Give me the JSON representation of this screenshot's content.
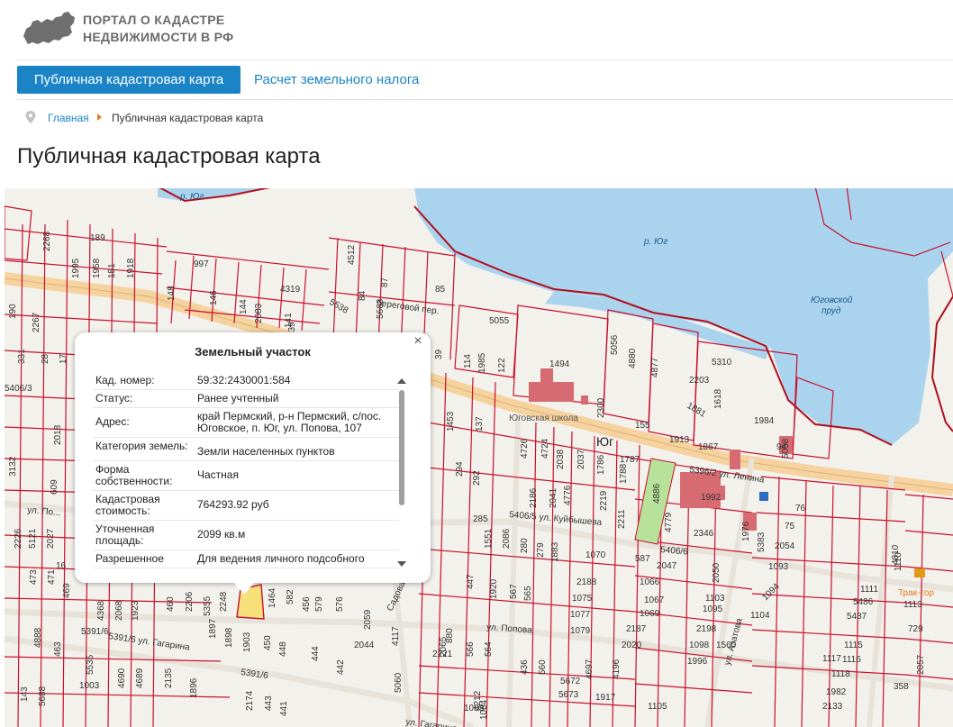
{
  "header": {
    "logo_line1": "ПОРТАЛ О КАДАСТРЕ",
    "logo_line2": "НЕДВИЖИМОСТИ В РФ"
  },
  "nav": {
    "tab_active": "Публичная кадастровая карта",
    "tab_other": "Расчет земельного налога"
  },
  "breadcrumb": {
    "home": "Главная",
    "current": "Публичная кадастровая карта"
  },
  "page_title": "Публичная кадастровая карта",
  "popup": {
    "title": "Земельный участок",
    "close": "×",
    "rows": [
      {
        "key": "Кад. номер:",
        "value": "59:32:2430001:584"
      },
      {
        "key": "Статус:",
        "value": "Ранее учтенный"
      },
      {
        "key": "Адрес:",
        "value": "край Пермский, р-н Пермский, с/пос. Юговское, п. Юг, ул. Попова, 107"
      },
      {
        "key": "Категория земель:",
        "value": "Земли населенных пунктов"
      },
      {
        "key": "Форма собственности:",
        "value": "Частная"
      },
      {
        "key": "Кадастровая стоимость:",
        "value": "764293.92 руб"
      },
      {
        "key": "Уточненная площадь:",
        "value": "2099 кв.м"
      },
      {
        "key": "Разрешенное",
        "value": "Для ведения личного подсобного"
      }
    ]
  },
  "map": {
    "colors": {
      "water": "#aad3ee",
      "parcel": "#c8102e",
      "road": "#f5d29e",
      "highlight": "#f7e07a",
      "building": "#d76b72"
    },
    "labels": [
      {
        "id": "river_top",
        "text": "р. Юг"
      },
      {
        "id": "river_mid",
        "text": "р. Юг"
      },
      {
        "id": "pond1",
        "text": "Юговской"
      },
      {
        "id": "pond2",
        "text": "пруд"
      },
      {
        "id": "street_lenina",
        "text": "5396/2 ул. Ленина"
      },
      {
        "id": "street_kuib",
        "text": "5406/5 ул. Куйбышева"
      },
      {
        "id": "street_5406_6",
        "text": "5406/6"
      },
      {
        "id": "street_popova",
        "text": "ул. Попова"
      },
      {
        "id": "street_gagarina",
        "text": "5391/6 ул. Гагарина"
      },
      {
        "id": "street_5391_6",
        "text": "5391/6"
      },
      {
        "id": "street_beregovoi",
        "text": "береговой пер."
      },
      {
        "id": "street_pol",
        "text": "ул. По..."
      },
      {
        "id": "street_sadovaya",
        "text": "Садовая"
      },
      {
        "id": "street_azatova",
        "text": "ул. Азатова"
      },
      {
        "id": "street_gagarina2",
        "text": "ул. Гагарина"
      },
      {
        "id": "school",
        "text": "Юговская школа"
      },
      {
        "id": "place_yug",
        "text": "Юг"
      },
      {
        "id": "poi_trak",
        "text": "Трак-тор"
      },
      {
        "id": "n5055",
        "text": "5055"
      },
      {
        "id": "n1494",
        "text": "1494"
      },
      {
        "id": "n5310",
        "text": "5310"
      },
      {
        "id": "n1984",
        "text": "1984"
      },
      {
        "id": "n2203",
        "text": "2203"
      },
      {
        "id": "n1618",
        "text": "1618"
      },
      {
        "id": "n1881",
        "text": "1881"
      },
      {
        "id": "n4880",
        "text": "4880"
      },
      {
        "id": "n4877",
        "text": "4877"
      },
      {
        "id": "n5056",
        "text": "5056"
      },
      {
        "id": "n2300",
        "text": "2300"
      },
      {
        "id": "n155",
        "text": "155"
      },
      {
        "id": "n1913",
        "text": "1913"
      },
      {
        "id": "n1867",
        "text": "1867"
      },
      {
        "id": "n1992",
        "text": "1992"
      },
      {
        "id": "n2346",
        "text": "2346"
      },
      {
        "id": "n4886",
        "text": "4886"
      },
      {
        "id": "n4779",
        "text": "4779"
      },
      {
        "id": "n1787",
        "text": "1787"
      },
      {
        "id": "n1788",
        "text": "1788"
      },
      {
        "id": "n1786",
        "text": "1786"
      },
      {
        "id": "n2219",
        "text": "2219"
      },
      {
        "id": "n2211",
        "text": "2211"
      },
      {
        "id": "n4776",
        "text": "4776"
      },
      {
        "id": "n2041",
        "text": "2041"
      },
      {
        "id": "n2186",
        "text": "2186"
      },
      {
        "id": "n2038",
        "text": "2038"
      },
      {
        "id": "n2037",
        "text": "2037"
      },
      {
        "id": "n4726",
        "text": "4726"
      },
      {
        "id": "n4724",
        "text": "4724"
      },
      {
        "id": "n1070",
        "text": "1070"
      },
      {
        "id": "n2188",
        "text": "2188"
      },
      {
        "id": "n1075",
        "text": "1075"
      },
      {
        "id": "n1077",
        "text": "1077"
      },
      {
        "id": "n1079",
        "text": "1079"
      },
      {
        "id": "n1066",
        "text": "1066"
      },
      {
        "id": "n1067",
        "text": "1067"
      },
      {
        "id": "n1069",
        "text": "1069"
      },
      {
        "id": "n2187",
        "text": "2187"
      },
      {
        "id": "n2020",
        "text": "2020"
      },
      {
        "id": "n1103",
        "text": "1103"
      },
      {
        "id": "n1095",
        "text": "1095"
      },
      {
        "id": "n2198",
        "text": "2198"
      },
      {
        "id": "n1098",
        "text": "1098"
      },
      {
        "id": "n1560",
        "text": "1560"
      },
      {
        "id": "n1996",
        "text": "1996"
      },
      {
        "id": "n2047",
        "text": "2047"
      },
      {
        "id": "n2050",
        "text": "2050"
      },
      {
        "id": "n587",
        "text": "587"
      },
      {
        "id": "n1093",
        "text": "1093"
      },
      {
        "id": "n2054",
        "text": "2054"
      },
      {
        "id": "n1094",
        "text": "1094"
      },
      {
        "id": "n1104",
        "text": "1104"
      },
      {
        "id": "n1976",
        "text": "1976"
      },
      {
        "id": "n5383",
        "text": "5383"
      },
      {
        "id": "n75",
        "text": "75"
      },
      {
        "id": "n76",
        "text": "76"
      },
      {
        "id": "n4810",
        "text": "4810"
      },
      {
        "id": "n5486",
        "text": "5486"
      },
      {
        "id": "n5487",
        "text": "5487"
      },
      {
        "id": "n1111",
        "text": "1111"
      },
      {
        "id": "n1110",
        "text": "1110"
      },
      {
        "id": "n1113",
        "text": "1113"
      },
      {
        "id": "n729",
        "text": "729"
      },
      {
        "id": "n1115",
        "text": "1115"
      },
      {
        "id": "n1117",
        "text": "1117"
      },
      {
        "id": "n1116",
        "text": "1116"
      },
      {
        "id": "n1118",
        "text": "1118"
      },
      {
        "id": "n1982",
        "text": "1982"
      },
      {
        "id": "n2133",
        "text": "2133"
      },
      {
        "id": "n2057",
        "text": "2057"
      },
      {
        "id": "n358",
        "text": "358"
      },
      {
        "id": "n1464",
        "text": "1464"
      },
      {
        "id": "n582",
        "text": "582"
      },
      {
        "id": "n456",
        "text": "456"
      },
      {
        "id": "n579",
        "text": "579"
      },
      {
        "id": "n576",
        "text": "576"
      },
      {
        "id": "n2059",
        "text": "2059"
      },
      {
        "id": "n2044",
        "text": "2044"
      },
      {
        "id": "n1920",
        "text": "1920"
      },
      {
        "id": "n567",
        "text": "567"
      },
      {
        "id": "n565",
        "text": "565"
      },
      {
        "id": "n447",
        "text": "447"
      },
      {
        "id": "n2221",
        "text": "2221"
      },
      {
        "id": "n1083",
        "text": "1083"
      },
      {
        "id": "n1084",
        "text": "1084"
      },
      {
        "id": "n2044b",
        "text": "4117"
      },
      {
        "id": "n2065",
        "text": "2065"
      },
      {
        "id": "n880",
        "text": "880"
      },
      {
        "id": "n566",
        "text": "566"
      },
      {
        "id": "n564",
        "text": "564"
      },
      {
        "id": "n436",
        "text": "436"
      },
      {
        "id": "n560",
        "text": "560"
      },
      {
        "id": "n5672",
        "text": "5672"
      },
      {
        "id": "n5673",
        "text": "5673"
      },
      {
        "id": "n1917",
        "text": "1917"
      },
      {
        "id": "n4697",
        "text": "4697"
      },
      {
        "id": "n1105",
        "text": "1105"
      },
      {
        "id": "n4196",
        "text": "4196"
      },
      {
        "id": "n5060",
        "text": "5060"
      },
      {
        "id": "n1903",
        "text": "1903"
      },
      {
        "id": "n450",
        "text": "450"
      },
      {
        "id": "n448",
        "text": "448"
      },
      {
        "id": "n444",
        "text": "444"
      },
      {
        "id": "n442",
        "text": "442"
      },
      {
        "id": "n1898",
        "text": "1898"
      },
      {
        "id": "n2135",
        "text": "2135"
      },
      {
        "id": "n4212",
        "text": "4212"
      },
      {
        "id": "n5535",
        "text": "5535"
      },
      {
        "id": "n4690",
        "text": "4690"
      },
      {
        "id": "n4689",
        "text": "4689"
      },
      {
        "id": "n1003",
        "text": "1003"
      },
      {
        "id": "n4888",
        "text": "4888"
      },
      {
        "id": "n463",
        "text": "463"
      },
      {
        "id": "n5688",
        "text": "5688"
      },
      {
        "id": "n143",
        "text": "143"
      },
      {
        "id": "n2174",
        "text": "2174"
      },
      {
        "id": "n443",
        "text": "443"
      },
      {
        "id": "n1896",
        "text": "1896"
      },
      {
        "id": "n441",
        "text": "441"
      },
      {
        "id": "n4512",
        "text": "4512"
      },
      {
        "id": "n997",
        "text": "997"
      },
      {
        "id": "n189",
        "text": "189"
      },
      {
        "id": "n4319",
        "text": "4319"
      },
      {
        "id": "n5538",
        "text": "5538"
      },
      {
        "id": "n87",
        "text": "87"
      },
      {
        "id": "n85",
        "text": "85"
      },
      {
        "id": "n84",
        "text": "84"
      },
      {
        "id": "n5663",
        "text": "5663"
      },
      {
        "id": "n1918",
        "text": "1918"
      },
      {
        "id": "n1995",
        "text": "1995"
      },
      {
        "id": "n1958",
        "text": "1958"
      },
      {
        "id": "n151",
        "text": "151"
      },
      {
        "id": "n148",
        "text": "148"
      },
      {
        "id": "n146",
        "text": "146"
      },
      {
        "id": "n144",
        "text": "144"
      },
      {
        "id": "n2083",
        "text": "2083"
      },
      {
        "id": "n141",
        "text": "141"
      },
      {
        "id": "n139",
        "text": "139"
      },
      {
        "id": "n2267",
        "text": "2267"
      },
      {
        "id": "n2268",
        "text": "2268"
      },
      {
        "id": "n190",
        "text": "190"
      },
      {
        "id": "n331",
        "text": "331"
      },
      {
        "id": "n28",
        "text": "28"
      },
      {
        "id": "n17",
        "text": "17"
      },
      {
        "id": "n5406_3",
        "text": "5406/3"
      },
      {
        "id": "n3132",
        "text": "3132"
      },
      {
        "id": "n2018",
        "text": "2018"
      },
      {
        "id": "n609",
        "text": "609"
      },
      {
        "id": "n2027",
        "text": "2027"
      },
      {
        "id": "n5121",
        "text": "5121"
      },
      {
        "id": "n2226",
        "text": "2226"
      },
      {
        "id": "n473",
        "text": "473"
      },
      {
        "id": "n471",
        "text": "471"
      },
      {
        "id": "n469",
        "text": "469"
      },
      {
        "id": "n39",
        "text": "39"
      },
      {
        "id": "n114",
        "text": "114"
      },
      {
        "id": "n1985",
        "text": "1985"
      },
      {
        "id": "n122",
        "text": "122"
      },
      {
        "id": "n1453",
        "text": "1453"
      },
      {
        "id": "n137",
        "text": "137"
      },
      {
        "id": "n294",
        "text": "294"
      },
      {
        "id": "n292",
        "text": "292"
      },
      {
        "id": "n285",
        "text": "285"
      },
      {
        "id": "n1551",
        "text": "1551"
      },
      {
        "id": "n2086",
        "text": "2086"
      },
      {
        "id": "n280",
        "text": "280"
      },
      {
        "id": "n279",
        "text": "279"
      },
      {
        "id": "n1883",
        "text": "1883"
      },
      {
        "id": "n4368",
        "text": "4368"
      },
      {
        "id": "n2068",
        "text": "2068"
      },
      {
        "id": "n1923",
        "text": "1923"
      },
      {
        "id": "n460",
        "text": "460"
      },
      {
        "id": "n2206",
        "text": "2206"
      },
      {
        "id": "n5355",
        "text": "5355"
      },
      {
        "id": "n2248",
        "text": "2248"
      },
      {
        "id": "n1897",
        "text": "1897"
      },
      {
        "id": "n5391_6",
        "text": "5391/6"
      },
      {
        "id": "n16",
        "text": "16"
      },
      {
        "id": "n94",
        "text": "94"
      },
      {
        "id": "n5058",
        "text": "5058"
      }
    ]
  }
}
